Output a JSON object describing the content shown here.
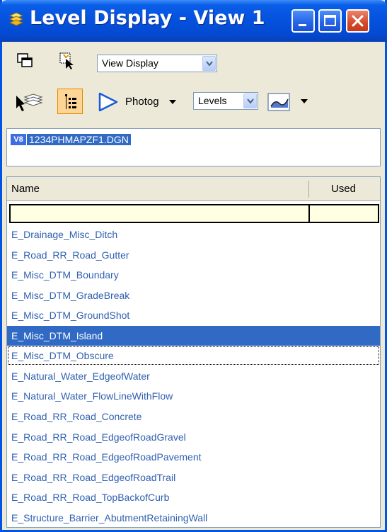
{
  "window": {
    "title": "Level Display - View 1",
    "accent": "#0054e3"
  },
  "toolbar": {
    "display_mode_value": "View Display",
    "photog_label": "Photog",
    "levels_value": "Levels"
  },
  "file": {
    "badge": "V8",
    "name": "1234PHMAPZF1.DGN"
  },
  "list": {
    "columns": {
      "name": "Name",
      "used": "Used"
    },
    "filter": {
      "name": "",
      "used": ""
    },
    "items": [
      {
        "label": "E_Drainage_Misc_Ditch"
      },
      {
        "label": "E_Road_RR_Road_Gutter"
      },
      {
        "label": "E_Misc_DTM_Boundary"
      },
      {
        "label": "E_Misc_DTM_GradeBreak"
      },
      {
        "label": "E_Misc_DTM_GroundShot"
      },
      {
        "label": "E_Misc_DTM_Island",
        "state": "selected"
      },
      {
        "label": "E_Misc_DTM_Obscure",
        "state": "focused"
      },
      {
        "label": "E_Natural_Water_EdgeofWater"
      },
      {
        "label": "E_Natural_Water_FlowLineWithFlow"
      },
      {
        "label": "E_Road_RR_Road_Concrete"
      },
      {
        "label": "E_Road_RR_Road_EdgeofRoadGravel"
      },
      {
        "label": "E_Road_RR_Road_EdgeofRoadPavement"
      },
      {
        "label": "E_Road_RR_Road_EdgeofRoadTrail"
      },
      {
        "label": "E_Road_RR_Road_TopBackofCurb"
      },
      {
        "label": "E_Structure_Barrier_AbutmentRetainingWall"
      }
    ]
  }
}
